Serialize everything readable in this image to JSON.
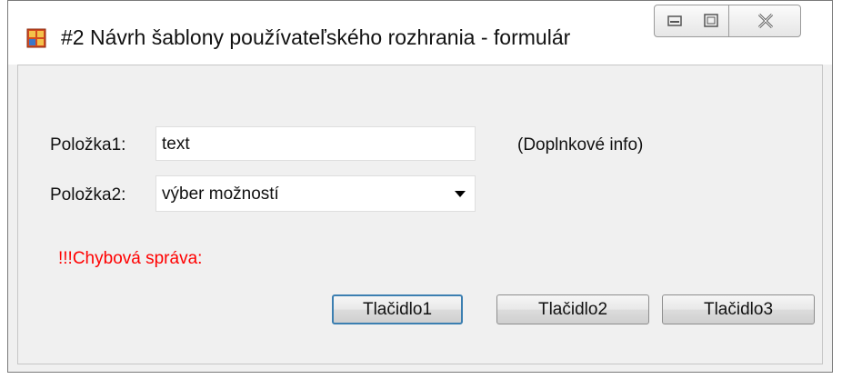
{
  "window": {
    "title": "#2 Návrh šablony používateľského rozhrania - formulár",
    "icons": [
      "app-form-icon",
      "minimize-icon",
      "maximize-icon",
      "close-icon"
    ]
  },
  "form": {
    "field1": {
      "label": "Položka1:",
      "value": "text",
      "info": "(Doplnkové info)"
    },
    "field2": {
      "label": "Položka2:",
      "selected": "výber možností"
    },
    "error": "!!!Chybová správa:"
  },
  "buttons": {
    "button1": "Tlačidlo1",
    "button2": "Tlačidlo2",
    "button3": "Tlačidlo3"
  },
  "colors": {
    "error_text": "#ff0000",
    "default_button_border": "#3c7fb1",
    "client_background": "#f0f0f0"
  }
}
